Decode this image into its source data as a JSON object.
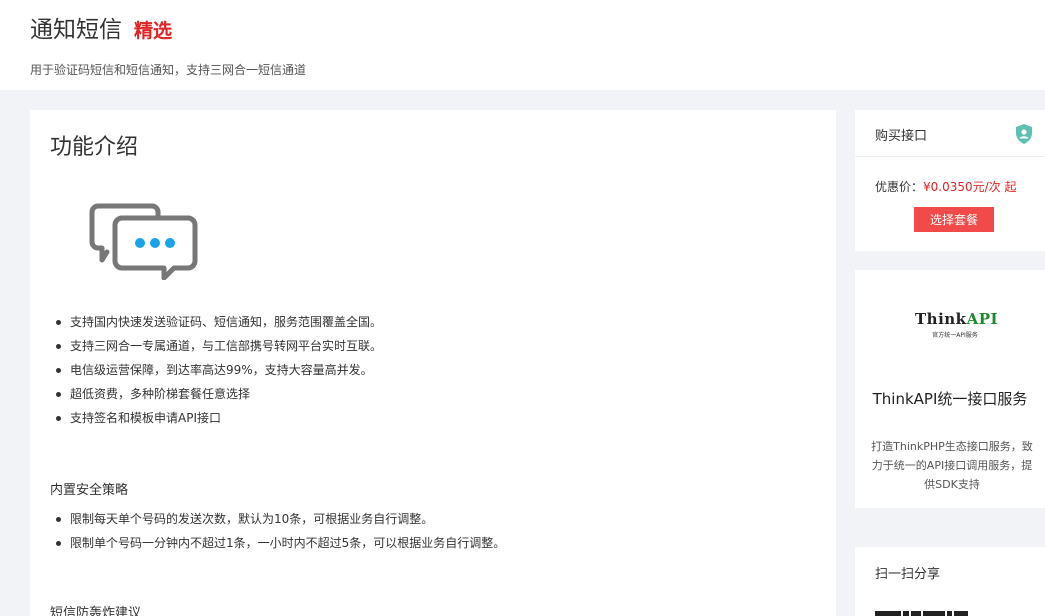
{
  "header": {
    "title": "通知短信",
    "badge": "精选",
    "subtitle": "用于验证码短信和短信通知，支持三网合一短信通道"
  },
  "main": {
    "section_title": "功能介绍",
    "features": [
      "支持国内快速发送验证码、短信通知，服务范围覆盖全国。",
      "支持三网合一专属通道，与工信部携号转网平台实时互联。",
      "电信级运营保障，到达率高达99%，支持大容量高并发。",
      "超低资费，多种阶梯套餐任意选择",
      "支持签名和模板申请API接口"
    ],
    "policy_title": "内置安全策略",
    "policies": [
      "限制每天单个号码的发送次数，默认为10条，可根据业务自行调整。",
      "限制单个号码一分钟内不超过1条，一小时内不超过5条，可以根据业务自行调整。"
    ],
    "defense_title": "短信防轰炸建议"
  },
  "buy": {
    "title": "购买接口",
    "price_label": "优惠价：",
    "price_value": "¥0.0350元/次 起",
    "button_label": "选择套餐"
  },
  "ad": {
    "logo_main": "Think",
    "logo_api": "API",
    "logo_tag": "官方统一API服务",
    "title": "ThinkAPI统一接口服务",
    "desc": "打造ThinkPHP生态接口服务，致力于统一的API接口调用服务，提供SDK支持"
  },
  "share": {
    "title": "扫一扫分享"
  },
  "colors": {
    "accent_red": "#e02424",
    "button_red": "#f04a4a",
    "dots_blue": "#1aa3e8",
    "shield_teal": "#5fbfb3",
    "logo_green": "#1a8a2c"
  },
  "icons": {
    "chat": "chat-bubbles-icon",
    "shield": "shield-user-icon"
  }
}
